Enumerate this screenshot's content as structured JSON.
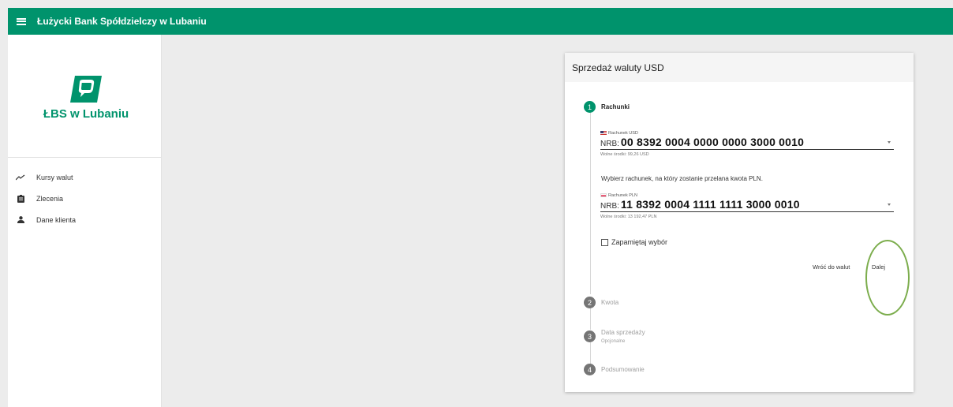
{
  "header": {
    "title": "Łużycki Bank Spółdzielczy w Lubaniu"
  },
  "sidebar": {
    "logo_text": "ŁBS w Lubaniu",
    "items": [
      {
        "label": "Kursy walut",
        "icon": "trend-chart-icon"
      },
      {
        "label": "Zlecenia",
        "icon": "clipboard-icon"
      },
      {
        "label": "Dane klienta",
        "icon": "person-icon"
      }
    ]
  },
  "card": {
    "title": "Sprzedaż waluty USD",
    "steps": [
      {
        "number": "1",
        "label": "Rachunki",
        "sub": ""
      },
      {
        "number": "2",
        "label": "Kwota",
        "sub": ""
      },
      {
        "number": "3",
        "label": "Data sprzedaży",
        "sub": "Opcjonalne"
      },
      {
        "number": "4",
        "label": "Podsumowanie",
        "sub": ""
      }
    ],
    "usd_account": {
      "label": "Rachunek USD",
      "prefix": "NRB:",
      "number": "00 8392 0004 0000 0000 3000 0010",
      "hint": "Wolne środki: 99,26 USD"
    },
    "instruction": "Wybierz rachunek, na który zostanie przelana kwota PLN.",
    "pln_account": {
      "label": "Rachunek PLN",
      "prefix": "NRB:",
      "number": "11 8392 0004 1111 1111 3000 0010",
      "hint": "Wolne środki: 13 192,47 PLN"
    },
    "remember_label": "Zapamiętaj wybór",
    "remember_checked": false,
    "back_label": "Wróć do walut",
    "next_label": "Dalej"
  },
  "colors": {
    "brand": "#00936c",
    "annotation": "#7cad4d"
  }
}
